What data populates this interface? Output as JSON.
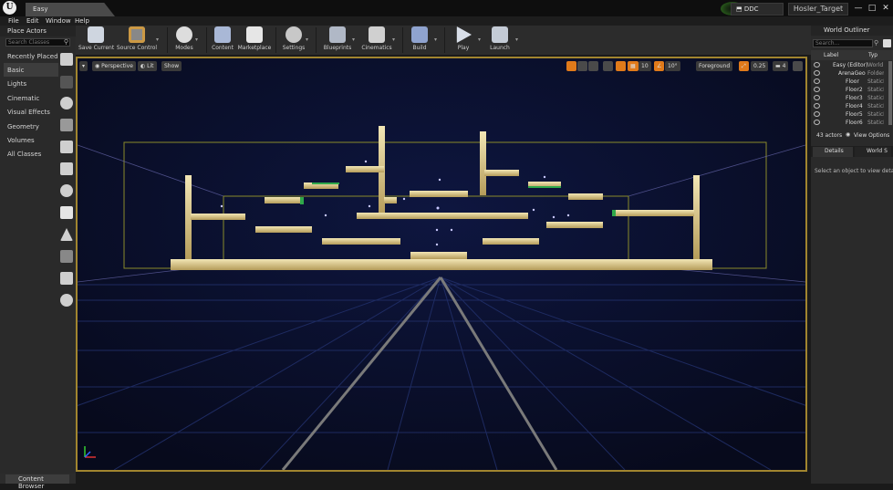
{
  "titlebar": {
    "tab": "Easy",
    "ddc": "DDC",
    "project": "Hosler_Target",
    "minimize": "—",
    "maximize": "□",
    "close": "✕"
  },
  "menubar": {
    "items": [
      "File",
      "Edit",
      "Window",
      "Help"
    ]
  },
  "place_actors": {
    "title": "Place Actors",
    "search_placeholder": "Search Classes",
    "categories": [
      "Recently Placed",
      "Basic",
      "Lights",
      "Cinematic",
      "Visual Effects",
      "Geometry",
      "Volumes",
      "All Classes"
    ],
    "selected": "Basic"
  },
  "toolbar": {
    "buttons": [
      {
        "label": "Save Current",
        "icon": "save-icon"
      },
      {
        "label": "Source Control",
        "icon": "source-control-icon"
      },
      {
        "label": "Modes",
        "icon": "modes-icon"
      },
      {
        "label": "Content",
        "icon": "content-icon"
      },
      {
        "label": "Marketplace",
        "icon": "marketplace-icon"
      },
      {
        "label": "Settings",
        "icon": "settings-icon"
      },
      {
        "label": "Blueprints",
        "icon": "blueprints-icon"
      },
      {
        "label": "Cinematics",
        "icon": "cinematics-icon"
      },
      {
        "label": "Build",
        "icon": "build-icon"
      },
      {
        "label": "Play",
        "icon": "play-icon"
      },
      {
        "label": "Launch",
        "icon": "launch-icon"
      }
    ]
  },
  "viewport": {
    "perspective": "Perspective",
    "lit": "Lit",
    "show": "Show",
    "grid_snap": "10",
    "rot_snap": "10°",
    "scale_snap": "0.25",
    "camera_speed": "4",
    "foreground": "Foreground",
    "menu_glyph": "▾"
  },
  "outliner": {
    "title": "World Outliner",
    "search_placeholder": "Search...",
    "col_label": "Label",
    "col_type": "Typ",
    "rows": [
      {
        "name": "Easy (Editor)",
        "type": "World"
      },
      {
        "name": "ArenaGeo",
        "type": "Folder"
      },
      {
        "name": "Floor",
        "type": "StaticM"
      },
      {
        "name": "Floor2",
        "type": "StaticM"
      },
      {
        "name": "Floor3",
        "type": "StaticM"
      },
      {
        "name": "Floor4",
        "type": "StaticM"
      },
      {
        "name": "Floor5",
        "type": "StaticM"
      },
      {
        "name": "Floor6",
        "type": "StaticM"
      }
    ],
    "actor_count": "43 actors",
    "view_options": "View Options"
  },
  "details": {
    "tab1": "Details",
    "tab2": "World S",
    "message": "Select an object to view details."
  },
  "content_browser": {
    "label": "Content Browser"
  },
  "colors": {
    "accent": "#a1852f",
    "sky": "#0a0d22",
    "platform": "#e8d9a0"
  }
}
